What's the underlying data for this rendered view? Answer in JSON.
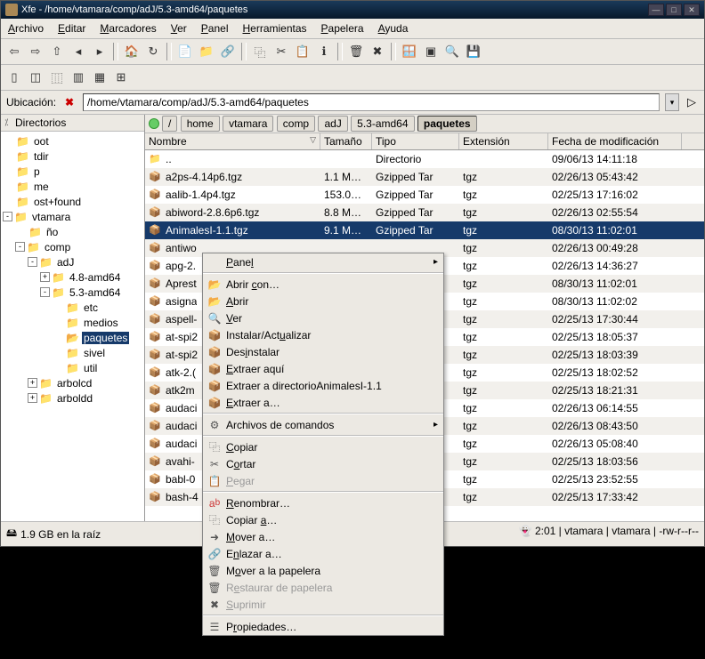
{
  "titlebar": {
    "app": "Xfe",
    "path": "/home/vtamara/comp/adJ/5.3-amd64/paquetes"
  },
  "menu": {
    "archivo": "Archivo",
    "editar": "Editar",
    "marcadores": "Marcadores",
    "ver": "Ver",
    "panel": "Panel",
    "herramientas": "Herramientas",
    "papelera": "Papelera",
    "ayuda": "Ayuda"
  },
  "location": {
    "label": "Ubicación:",
    "value": "/home/vtamara/comp/adJ/5.3-amd64/paquetes"
  },
  "tree_header": "Directorios",
  "tree": [
    {
      "lvl": 0,
      "tog": "",
      "label": "oot"
    },
    {
      "lvl": 0,
      "tog": "",
      "label": "tdir"
    },
    {
      "lvl": 0,
      "tog": "",
      "label": "p"
    },
    {
      "lvl": 0,
      "tog": "",
      "label": "me"
    },
    {
      "lvl": 0,
      "tog": "",
      "label": "ost+found"
    },
    {
      "lvl": 0,
      "tog": "-",
      "label": "vtamara"
    },
    {
      "lvl": 1,
      "tog": "",
      "label": "ño"
    },
    {
      "lvl": 1,
      "tog": "-",
      "label": "comp"
    },
    {
      "lvl": 2,
      "tog": "-",
      "label": "adJ"
    },
    {
      "lvl": 3,
      "tog": "+",
      "label": "4.8-amd64"
    },
    {
      "lvl": 3,
      "tog": "-",
      "label": "5.3-amd64"
    },
    {
      "lvl": 4,
      "tog": "",
      "label": "etc"
    },
    {
      "lvl": 4,
      "tog": "",
      "label": "medios"
    },
    {
      "lvl": 4,
      "tog": "",
      "label": "paquetes",
      "sel": true,
      "open": true
    },
    {
      "lvl": 4,
      "tog": "",
      "label": "sivel"
    },
    {
      "lvl": 4,
      "tog": "",
      "label": "util"
    },
    {
      "lvl": 2,
      "tog": "+",
      "label": "arbolcd"
    },
    {
      "lvl": 2,
      "tog": "+",
      "label": "arboldd"
    }
  ],
  "breadcrumbs": [
    "/",
    "home",
    "vtamara",
    "comp",
    "adJ",
    "5.3-amd64",
    "paquetes"
  ],
  "columns": {
    "name": "Nombre",
    "size": "Tamaño",
    "type": "Tipo",
    "ext": "Extensión",
    "date": "Fecha de modificación"
  },
  "rows": [
    {
      "name": "..",
      "size": "",
      "type": "Directorio",
      "ext": "",
      "date": "09/06/13 14:11:18",
      "ico": "📁"
    },
    {
      "name": "a2ps-4.14p6.tgz",
      "size": "1.1 M…",
      "type": "Gzipped Tar",
      "ext": "tgz",
      "date": "02/26/13 05:43:42",
      "ico": "📦"
    },
    {
      "name": "aalib-1.4p4.tgz",
      "size": "153.0…",
      "type": "Gzipped Tar",
      "ext": "tgz",
      "date": "02/25/13 17:16:02",
      "ico": "📦"
    },
    {
      "name": "abiword-2.8.6p6.tgz",
      "size": "8.8 M…",
      "type": "Gzipped Tar",
      "ext": "tgz",
      "date": "02/26/13 02:55:54",
      "ico": "📦"
    },
    {
      "name": "AnimalesI-1.1.tgz",
      "size": "9.1 M…",
      "type": "Gzipped Tar",
      "ext": "tgz",
      "date": "08/30/13 11:02:01",
      "ico": "📦",
      "sel": true
    },
    {
      "name": "antiwo",
      "size": "",
      "type": "",
      "ext": "tgz",
      "date": "02/26/13 00:49:28",
      "ico": "📦"
    },
    {
      "name": "apg-2.",
      "size": "",
      "type": "",
      "ext": "tgz",
      "date": "02/26/13 14:36:27",
      "ico": "📦"
    },
    {
      "name": "Aprest",
      "size": "",
      "type": "",
      "ext": "tgz",
      "date": "08/30/13 11:02:01",
      "ico": "📦"
    },
    {
      "name": "asigna",
      "size": "",
      "type": "",
      "ext": "tgz",
      "date": "08/30/13 11:02:02",
      "ico": "📦"
    },
    {
      "name": "aspell-",
      "size": "",
      "type": "",
      "ext": "tgz",
      "date": "02/25/13 17:30:44",
      "ico": "📦"
    },
    {
      "name": "at-spi2",
      "size": "",
      "type": "",
      "ext": "tgz",
      "date": "02/25/13 18:05:37",
      "ico": "📦"
    },
    {
      "name": "at-spi2",
      "size": "",
      "type": "",
      "ext": "tgz",
      "date": "02/25/13 18:03:39",
      "ico": "📦"
    },
    {
      "name": "atk-2.(",
      "size": "",
      "type": "",
      "ext": "tgz",
      "date": "02/25/13 18:02:52",
      "ico": "📦"
    },
    {
      "name": "atk2m",
      "size": "",
      "type": "",
      "ext": "tgz",
      "date": "02/25/13 18:21:31",
      "ico": "📦"
    },
    {
      "name": "audaci",
      "size": "",
      "type": "",
      "ext": "tgz",
      "date": "02/26/13 06:14:55",
      "ico": "📦"
    },
    {
      "name": "audaci",
      "size": "",
      "type": "",
      "ext": "tgz",
      "date": "02/26/13 08:43:50",
      "ico": "📦"
    },
    {
      "name": "audaci",
      "size": "",
      "type": "",
      "ext": "tgz",
      "date": "02/26/13 05:08:40",
      "ico": "📦"
    },
    {
      "name": "avahi-",
      "size": "",
      "type": "",
      "ext": "tgz",
      "date": "02/25/13 18:03:56",
      "ico": "📦"
    },
    {
      "name": "babl-0",
      "size": "",
      "type": "",
      "ext": "tgz",
      "date": "02/25/13 23:52:55",
      "ico": "📦"
    },
    {
      "name": "bash-4",
      "size": "",
      "type": "",
      "ext": "tgz",
      "date": "02/25/13 17:33:42",
      "ico": "📦"
    }
  ],
  "status_left": "1.9 GB en la raíz",
  "status_right": "2:01 | vtamara | vtamara | -rw-r--r--",
  "ctx": {
    "panel": "Panel",
    "abrir_con": "Abrir con…",
    "abrir": "Abrir",
    "ver": "Ver",
    "instalar": "Instalar/Actualizar",
    "desinstalar": "Desinstalar",
    "extraer_aqui": "Extraer aquí",
    "extraer_nombre": "Extraer a directorioAnimalesI-1.1",
    "extraer_a": "Extraer a…",
    "archivos_cmd": "Archivos de comandos",
    "copiar": "Copiar",
    "cortar": "Cortar",
    "pegar": "Pegar",
    "renombrar": "Renombrar…",
    "copiar_a": "Copiar a…",
    "mover_a": "Mover a…",
    "enlazar_a": "Enlazar a…",
    "mover_papelera": "Mover a la papelera",
    "restaurar": "Restaurar de papelera",
    "suprimir": "Suprimir",
    "propiedades": "Propiedades…"
  }
}
